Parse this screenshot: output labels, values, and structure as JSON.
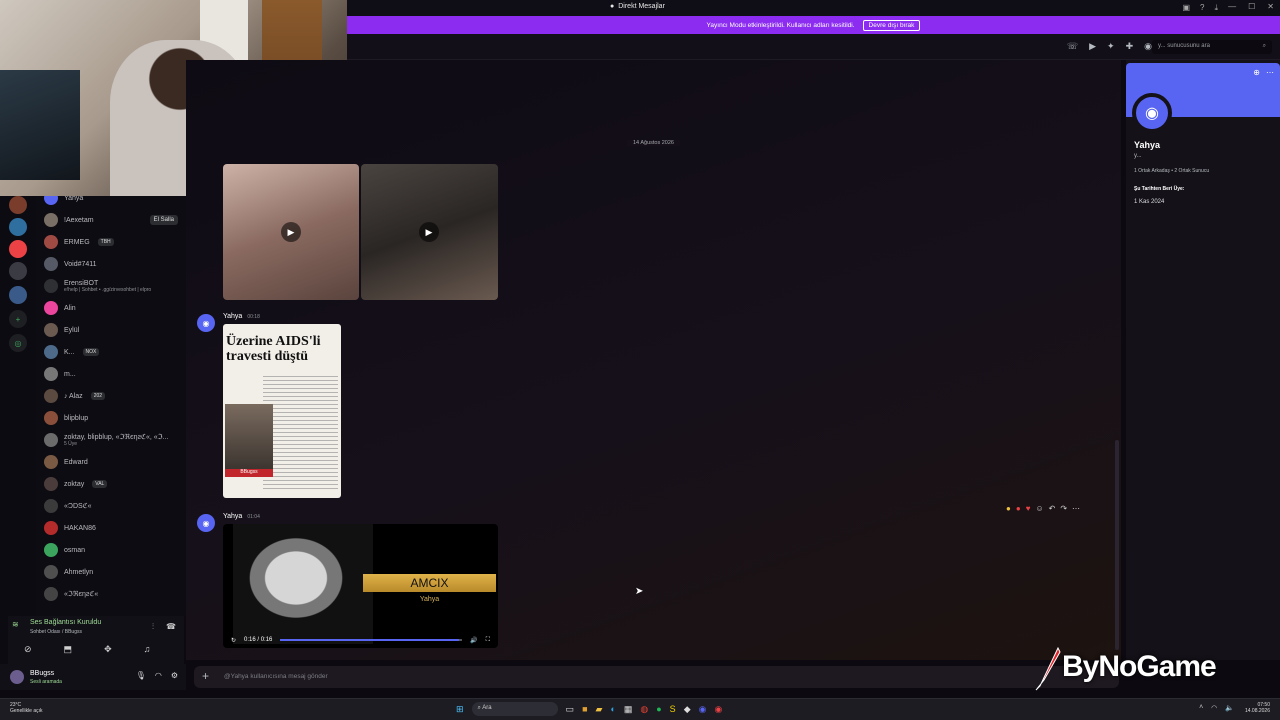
{
  "window": {
    "title": "Direkt Mesajlar"
  },
  "banner": {
    "text": "Yayıncı Modu etkinleştirildi. Kullanıcı adları kesitildi.",
    "button": "Devre dışı bırak"
  },
  "toolbar": {
    "search_placeholder": "y... sunucusunu ara"
  },
  "dm_list": [
    {
      "name": "Yahya",
      "sub": "",
      "badge": "",
      "status": "",
      "color": "#5865f2"
    },
    {
      "name": "!Aexetam",
      "sub": "",
      "badge": "",
      "status": "El Salla",
      "color": "#7a6f66"
    },
    {
      "name": "ERMEG",
      "sub": "",
      "badge": "TBH",
      "status": "",
      "color": "#a04a44"
    },
    {
      "name": "Void#7411",
      "sub": "",
      "badge": "",
      "status": "",
      "color": "#555a66"
    },
    {
      "name": "ErensiBOT",
      "sub": "e!help | Sohbet • .gg/zirvesohbet | elpro",
      "badge": "",
      "status": "",
      "color": "#2e3033"
    },
    {
      "name": "Alin",
      "sub": "",
      "badge": "",
      "status": "",
      "color": "#eb459e"
    },
    {
      "name": "Eylül",
      "sub": "",
      "badge": "",
      "status": "",
      "color": "#6a5a50"
    },
    {
      "name": "K...",
      "sub": "",
      "badge": "NOX",
      "status": "",
      "color": "#4d6a8a"
    },
    {
      "name": "m...",
      "sub": "",
      "badge": "",
      "status": "",
      "color": "#777"
    },
    {
      "name": "♪ Alaz",
      "sub": "",
      "badge": "202",
      "status": "",
      "color": "#5b4a3f"
    },
    {
      "name": "blipblup",
      "sub": "",
      "badge": "",
      "status": "",
      "color": "#8a4f3a"
    },
    {
      "name": "zoktay, blipblup, «ℑℜєηƨℭ«, «ℑ...",
      "sub": "5 Üye",
      "badge": "",
      "status": "",
      "color": "#6b6b6b"
    },
    {
      "name": "Edward",
      "sub": "",
      "badge": "",
      "status": "",
      "color": "#7b5a44"
    },
    {
      "name": "zoktay",
      "sub": "",
      "badge": "VAL",
      "status": "",
      "color": "#4a3c3a"
    },
    {
      "name": "«ϽDSℭ«",
      "sub": "",
      "badge": "",
      "status": "",
      "color": "#3b3b3b"
    },
    {
      "name": "HAKAN86",
      "sub": "",
      "badge": "",
      "status": "",
      "color": "#b32b2b"
    },
    {
      "name": "osman",
      "sub": "",
      "badge": "",
      "status": "",
      "color": "#3ba55d"
    },
    {
      "name": "Ahmetlyn",
      "sub": "",
      "badge": "",
      "status": "",
      "color": "#4f4f4f"
    },
    {
      "name": "«ℑℜєηƨℭ«",
      "sub": "",
      "badge": "",
      "status": "",
      "color": "#444"
    }
  ],
  "voice": {
    "title": "Ses Bağlantısı Kuruldu",
    "sub": "Sohbet Odası / BBugss"
  },
  "user": {
    "name": "BBugss",
    "status": "Sesli aramada"
  },
  "chat": {
    "date": "14 Ağustos 2026",
    "messages": [
      {
        "author": "Yahya",
        "time": "00:18"
      },
      {
        "author": "Yahya",
        "time": "01:04"
      }
    ],
    "newspaper_headline": "Üzerine AIDS'li travesti düştü",
    "newspaper_caption": "BBugss",
    "video_plate": "AMCIX",
    "video_plate_sub": "Yahya",
    "video_time": "0:16 / 0:16",
    "video_progress": 0.98,
    "composer_placeholder": "@Yahya kullanıcısına mesaj gönder"
  },
  "profile": {
    "name": "Yahya",
    "tag": "y...",
    "mutual": "1 Ortak Arkadaş • 2 Ortak Sunucu",
    "since_label": "Şu Tarihten Beri Üye:",
    "since": "1 Kas 2024"
  },
  "watermark": {
    "text": "ByNoGame"
  },
  "taskbar": {
    "weather_temp": "23°C",
    "weather_desc": "Genellikle açık",
    "search": "Ara",
    "time": "07:50",
    "date": "14.08.2026"
  },
  "colors": {
    "accent": "#5865f2",
    "banner": "#8b2cf0",
    "online": "#9fdc96"
  }
}
